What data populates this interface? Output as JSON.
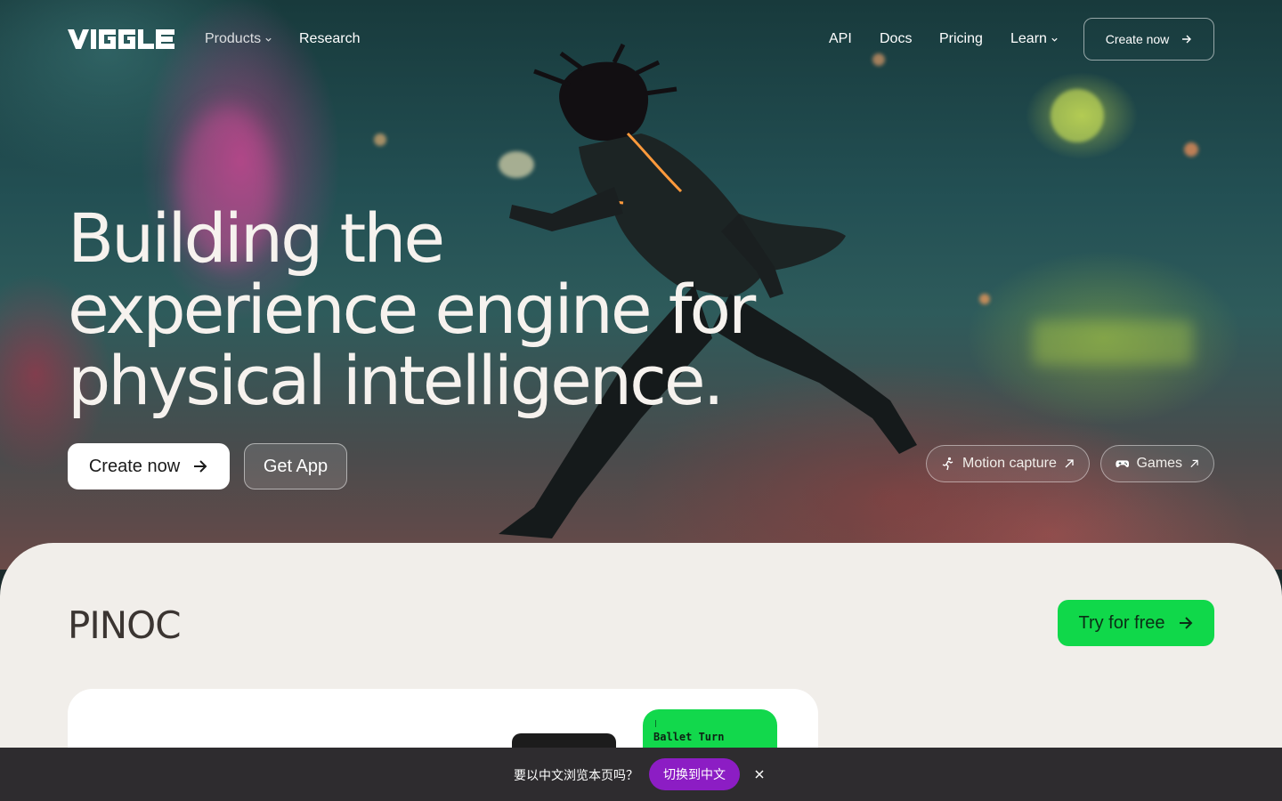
{
  "brand": {
    "logo_text": "VIGGLE"
  },
  "nav": {
    "products": "Products",
    "research": "Research",
    "api": "API",
    "docs": "Docs",
    "pricing": "Pricing",
    "learn": "Learn",
    "cta": "Create now"
  },
  "hero": {
    "headline_lines": [
      "Building the",
      "experience engine for",
      "physical intelligence."
    ],
    "primary_button": "Create now",
    "secondary_button": "Get App",
    "pills": [
      {
        "label": "Motion capture",
        "icon": "running-person-icon"
      },
      {
        "label": "Games",
        "icon": "gamepad-icon"
      }
    ]
  },
  "section": {
    "title": "PINOC",
    "cta": "Try for free",
    "card": {
      "green_label": "Ballet Turn"
    }
  },
  "language_banner": {
    "prompt": "要以中文浏览本页吗？",
    "button": "切换到中文"
  },
  "colors": {
    "accent_green": "#10d84a",
    "banner_button": "#8c1dc4",
    "section_bg": "#f1eeea"
  }
}
